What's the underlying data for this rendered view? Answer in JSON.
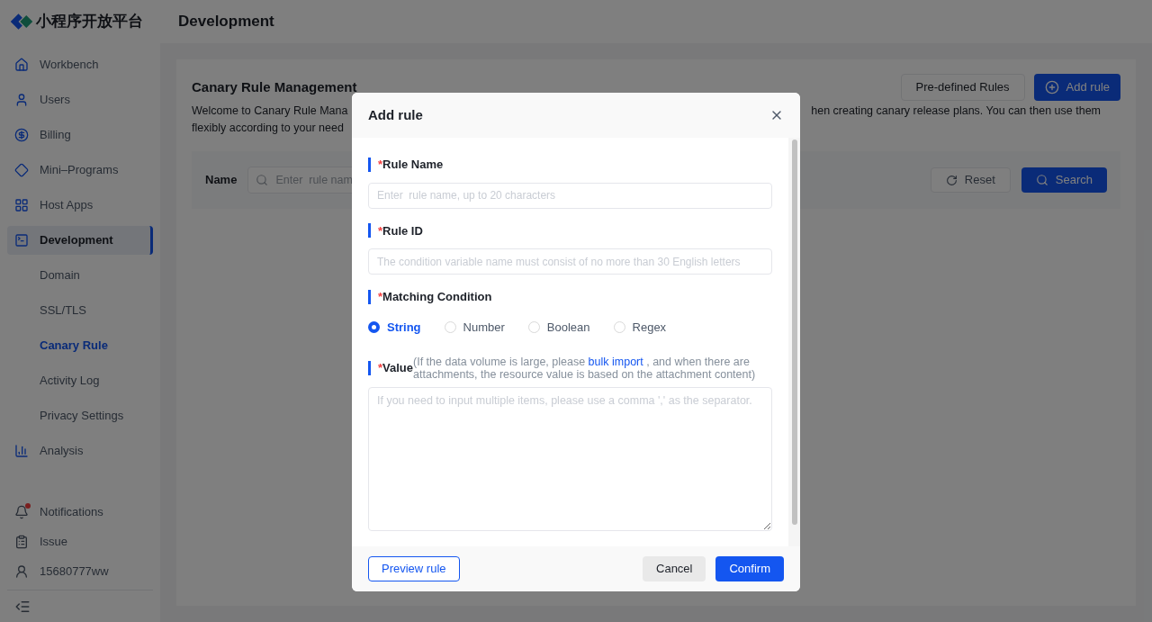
{
  "brand": {
    "name": "小程序开放平台"
  },
  "header": {
    "title": "Development"
  },
  "sidebar": {
    "items": [
      {
        "kind": "home",
        "label": "Workbench",
        "selected": false
      },
      {
        "kind": "user",
        "label": "Users",
        "selected": false
      },
      {
        "kind": "billing",
        "label": "Billing",
        "selected": false
      },
      {
        "kind": "diamond",
        "label": "Mini–Programs",
        "selected": false
      },
      {
        "kind": "grid",
        "label": "Host Apps",
        "selected": false
      },
      {
        "kind": "terminal",
        "label": "Development",
        "selected": true,
        "children": [
          {
            "label": "Domain",
            "selected": false
          },
          {
            "label": "SSL/TLS",
            "selected": false
          },
          {
            "label": "Canary Rule",
            "selected": true
          },
          {
            "label": "Activity Log",
            "selected": false
          },
          {
            "label": "Privacy Settings",
            "selected": false
          }
        ]
      },
      {
        "kind": "chart",
        "label": "Analysis",
        "selected": false
      }
    ],
    "footer_items": [
      {
        "kind": "bell",
        "label": "Notifications",
        "badge": true
      },
      {
        "kind": "clipboard",
        "label": "Issue",
        "badge": false
      },
      {
        "kind": "person",
        "label": "15680777ww",
        "badge": false
      }
    ]
  },
  "page": {
    "title": "Canary Rule Management",
    "buttons": [
      {
        "kind": "secondary",
        "label": "Pre-defined Rules"
      },
      {
        "kind": "primary",
        "label": "Add rule"
      }
    ],
    "description": {
      "line1_left": "Welcome to Canary Rule Mana",
      "line1_right": "hen creating canary release plans. You can then use them",
      "line2_left": "flexibly according to your need"
    },
    "filter": {
      "label": "Name",
      "placeholder": "Enter  rule nam",
      "reset": "Reset",
      "search": "Search"
    }
  },
  "dialog": {
    "title": "Add rule",
    "fields": [
      {
        "label": "Rule Name",
        "required_mark": "*",
        "placeholder": "Enter  rule name, up to 20 characters"
      },
      {
        "label": "Rule ID",
        "required_mark": "*",
        "placeholder": "The condition variable name must consist of no more than 30 English letters"
      }
    ],
    "matching": {
      "label": "Matching Condition",
      "required_mark": "*",
      "options": [
        {
          "label": "String",
          "selected": true
        },
        {
          "label": "Number",
          "selected": false
        },
        {
          "label": "Boolean",
          "selected": false
        },
        {
          "label": "Regex",
          "selected": false
        }
      ]
    },
    "value": {
      "label": "Value",
      "required_mark": "*",
      "hint_before": "(If the data volume is large, please ",
      "hint_link": "bulk import",
      "hint_after": " , and when there are attachments, the resource value is based on the attachment content)",
      "placeholder": "If you need to input multiple items, please use a comma ',' as the separator."
    },
    "footer": {
      "preview": "Preview rule",
      "cancel": "Cancel",
      "confirm": "Confirm"
    }
  }
}
